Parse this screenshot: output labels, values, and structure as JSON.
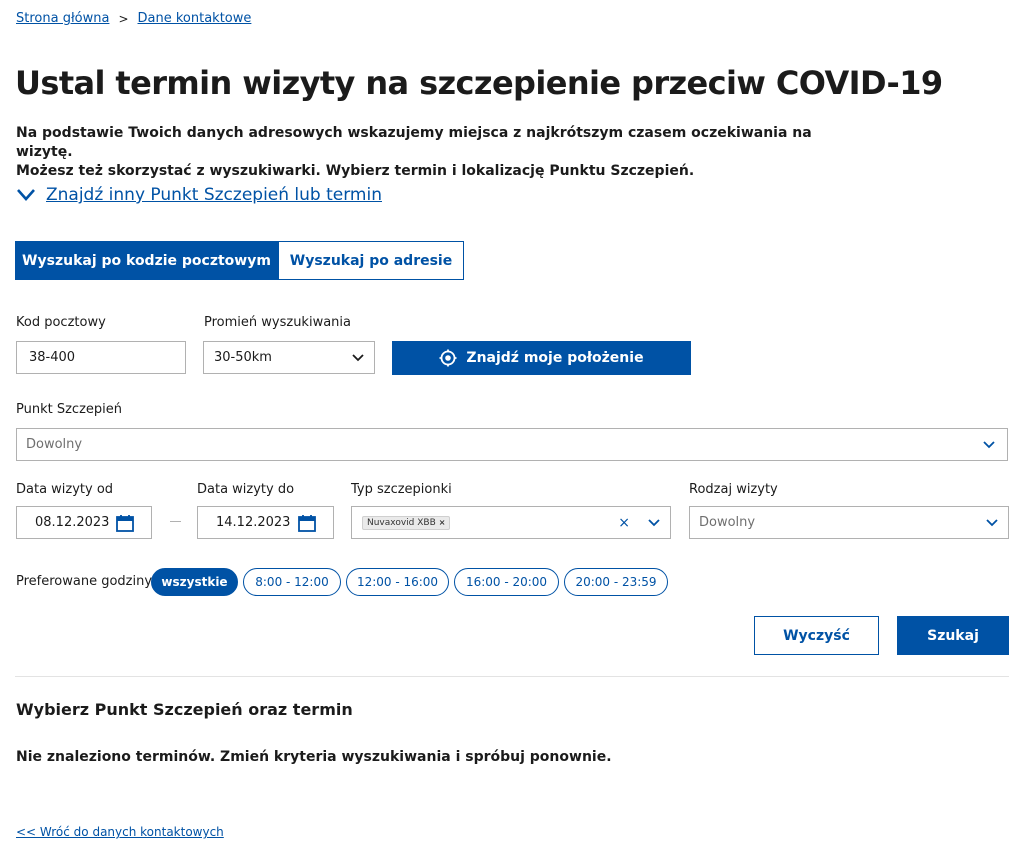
{
  "breadcrumb": {
    "home": "Strona główna",
    "separator": ">",
    "current": "Dane kontaktowe"
  },
  "page_title": "Ustal termin wizyty na szczepienie przeciw COVID-19",
  "intro": {
    "line1": "Na podstawie Twoich danych adresowych wskazujemy miejsca z najkrótszym czasem oczekiwania na wizytę.",
    "line2": "Możesz też skorzystać z wyszukiwarki. Wybierz termin i lokalizację Punktu Szczepień."
  },
  "toggle_link": "Znajdź inny Punkt Szczepień lub termin",
  "tabs": [
    {
      "label": "Wyszukaj po kodzie pocztowym",
      "active": true
    },
    {
      "label": "Wyszukaj po adresie",
      "active": false
    }
  ],
  "postal_code": {
    "label": "Kod pocztowy",
    "value": "38-400"
  },
  "radius": {
    "label": "Promień wyszukiwania",
    "value": "30-50km"
  },
  "locate_button": "Znajdź moje położenie",
  "vaccination_point": {
    "label": "Punkt Szczepień",
    "value": "Dowolny"
  },
  "date_from": {
    "label": "Data wizyty od",
    "value": "08.12.2023"
  },
  "date_to": {
    "label": "Data wizyty do",
    "value": "14.12.2023"
  },
  "vaccine_type": {
    "label": "Typ szczepionki",
    "tag": "Nuvaxovid XBB",
    "tag_remove": "×",
    "clear": "×"
  },
  "visit_type": {
    "label": "Rodzaj wizyty",
    "value": "Dowolny"
  },
  "preferred_hours": {
    "label": "Preferowane godziny:",
    "options": [
      "wszystkie",
      "8:00 - 12:00",
      "12:00 - 16:00",
      "16:00 - 20:00",
      "20:00 - 23:59"
    ],
    "selected": "wszystkie"
  },
  "buttons": {
    "clear": "Wyczyść",
    "search": "Szukaj"
  },
  "results": {
    "title": "Wybierz Punkt Szczepień oraz termin",
    "empty": "Nie znaleziono terminów. Zmień kryteria wyszukiwania i spróbuj ponownie."
  },
  "back_link": "<< Wróć do danych kontaktowych",
  "colors": {
    "primary": "#0052a5",
    "border": "#b1b1b1",
    "text": "#1b1b1b"
  }
}
